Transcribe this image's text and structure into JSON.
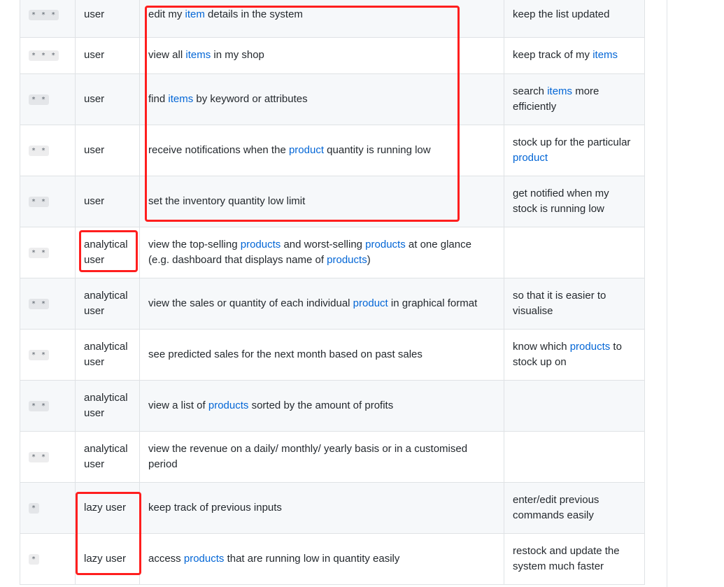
{
  "rows": [
    {
      "priority": "* * *",
      "role": "user",
      "want": [
        {
          "t": "edit my "
        },
        {
          "t": "item",
          "link": true
        },
        {
          "t": " details in the system"
        }
      ],
      "benefit": [
        {
          "t": "keep the list updated"
        }
      ]
    },
    {
      "priority": "* * *",
      "role": "user",
      "want": [
        {
          "t": "view all "
        },
        {
          "t": "items",
          "link": true
        },
        {
          "t": " in my shop"
        }
      ],
      "benefit": [
        {
          "t": "keep track of my "
        },
        {
          "t": "items",
          "link": true
        }
      ]
    },
    {
      "priority": "* *",
      "role": "user",
      "want": [
        {
          "t": "find "
        },
        {
          "t": "items",
          "link": true
        },
        {
          "t": " by keyword or attributes"
        }
      ],
      "benefit": [
        {
          "t": "search "
        },
        {
          "t": "items",
          "link": true
        },
        {
          "t": " more efficiently"
        }
      ]
    },
    {
      "priority": "* *",
      "role": "user",
      "want": [
        {
          "t": "receive notifications when the "
        },
        {
          "t": "product",
          "link": true
        },
        {
          "t": " quantity is running low"
        }
      ],
      "benefit": [
        {
          "t": "stock up for the particular "
        },
        {
          "t": "product",
          "link": true
        }
      ]
    },
    {
      "priority": "* *",
      "role": "user",
      "want": [
        {
          "t": "set the inventory quantity low limit"
        }
      ],
      "benefit": [
        {
          "t": "get notified when my stock is running low"
        }
      ]
    },
    {
      "priority": "* *",
      "role": "analytical user",
      "want": [
        {
          "t": "view the top-selling "
        },
        {
          "t": "products",
          "link": true
        },
        {
          "t": " and worst-selling "
        },
        {
          "t": "products",
          "link": true
        },
        {
          "t": " at one glance (e.g. dashboard that displays name of "
        },
        {
          "t": "products",
          "link": true
        },
        {
          "t": ")"
        }
      ],
      "benefit": []
    },
    {
      "priority": "* *",
      "role": "analytical user",
      "want": [
        {
          "t": "view the sales or quantity of each individual "
        },
        {
          "t": "product",
          "link": true
        },
        {
          "t": " in graphical format"
        }
      ],
      "benefit": [
        {
          "t": "so that it is easier to visualise"
        }
      ]
    },
    {
      "priority": "* *",
      "role": "analytical user",
      "want": [
        {
          "t": "see predicted sales for the next month based on past sales"
        }
      ],
      "benefit": [
        {
          "t": "know which "
        },
        {
          "t": "products",
          "link": true
        },
        {
          "t": " to stock up on"
        }
      ]
    },
    {
      "priority": "* *",
      "role": "analytical user",
      "want": [
        {
          "t": "view a list of "
        },
        {
          "t": "products",
          "link": true
        },
        {
          "t": " sorted by the amount of profits"
        }
      ],
      "benefit": []
    },
    {
      "priority": "* *",
      "role": "analytical user",
      "want": [
        {
          "t": "view the revenue on a daily/ monthly/ yearly basis or in a customised period"
        }
      ],
      "benefit": []
    },
    {
      "priority": "*",
      "role": "lazy user",
      "want": [
        {
          "t": "keep track of previous inputs"
        }
      ],
      "benefit": [
        {
          "t": "enter/edit previous commands easily"
        }
      ]
    },
    {
      "priority": "*",
      "role": "lazy user",
      "want": [
        {
          "t": "access "
        },
        {
          "t": "products",
          "link": true
        },
        {
          "t": " that are running low in quantity easily"
        }
      ],
      "benefit": [
        {
          "t": "restock and update the system much faster"
        }
      ]
    }
  ],
  "colors": {
    "link": "#0366d6",
    "highlight": "#ff1e1e",
    "stripe": "#f6f8fa"
  }
}
